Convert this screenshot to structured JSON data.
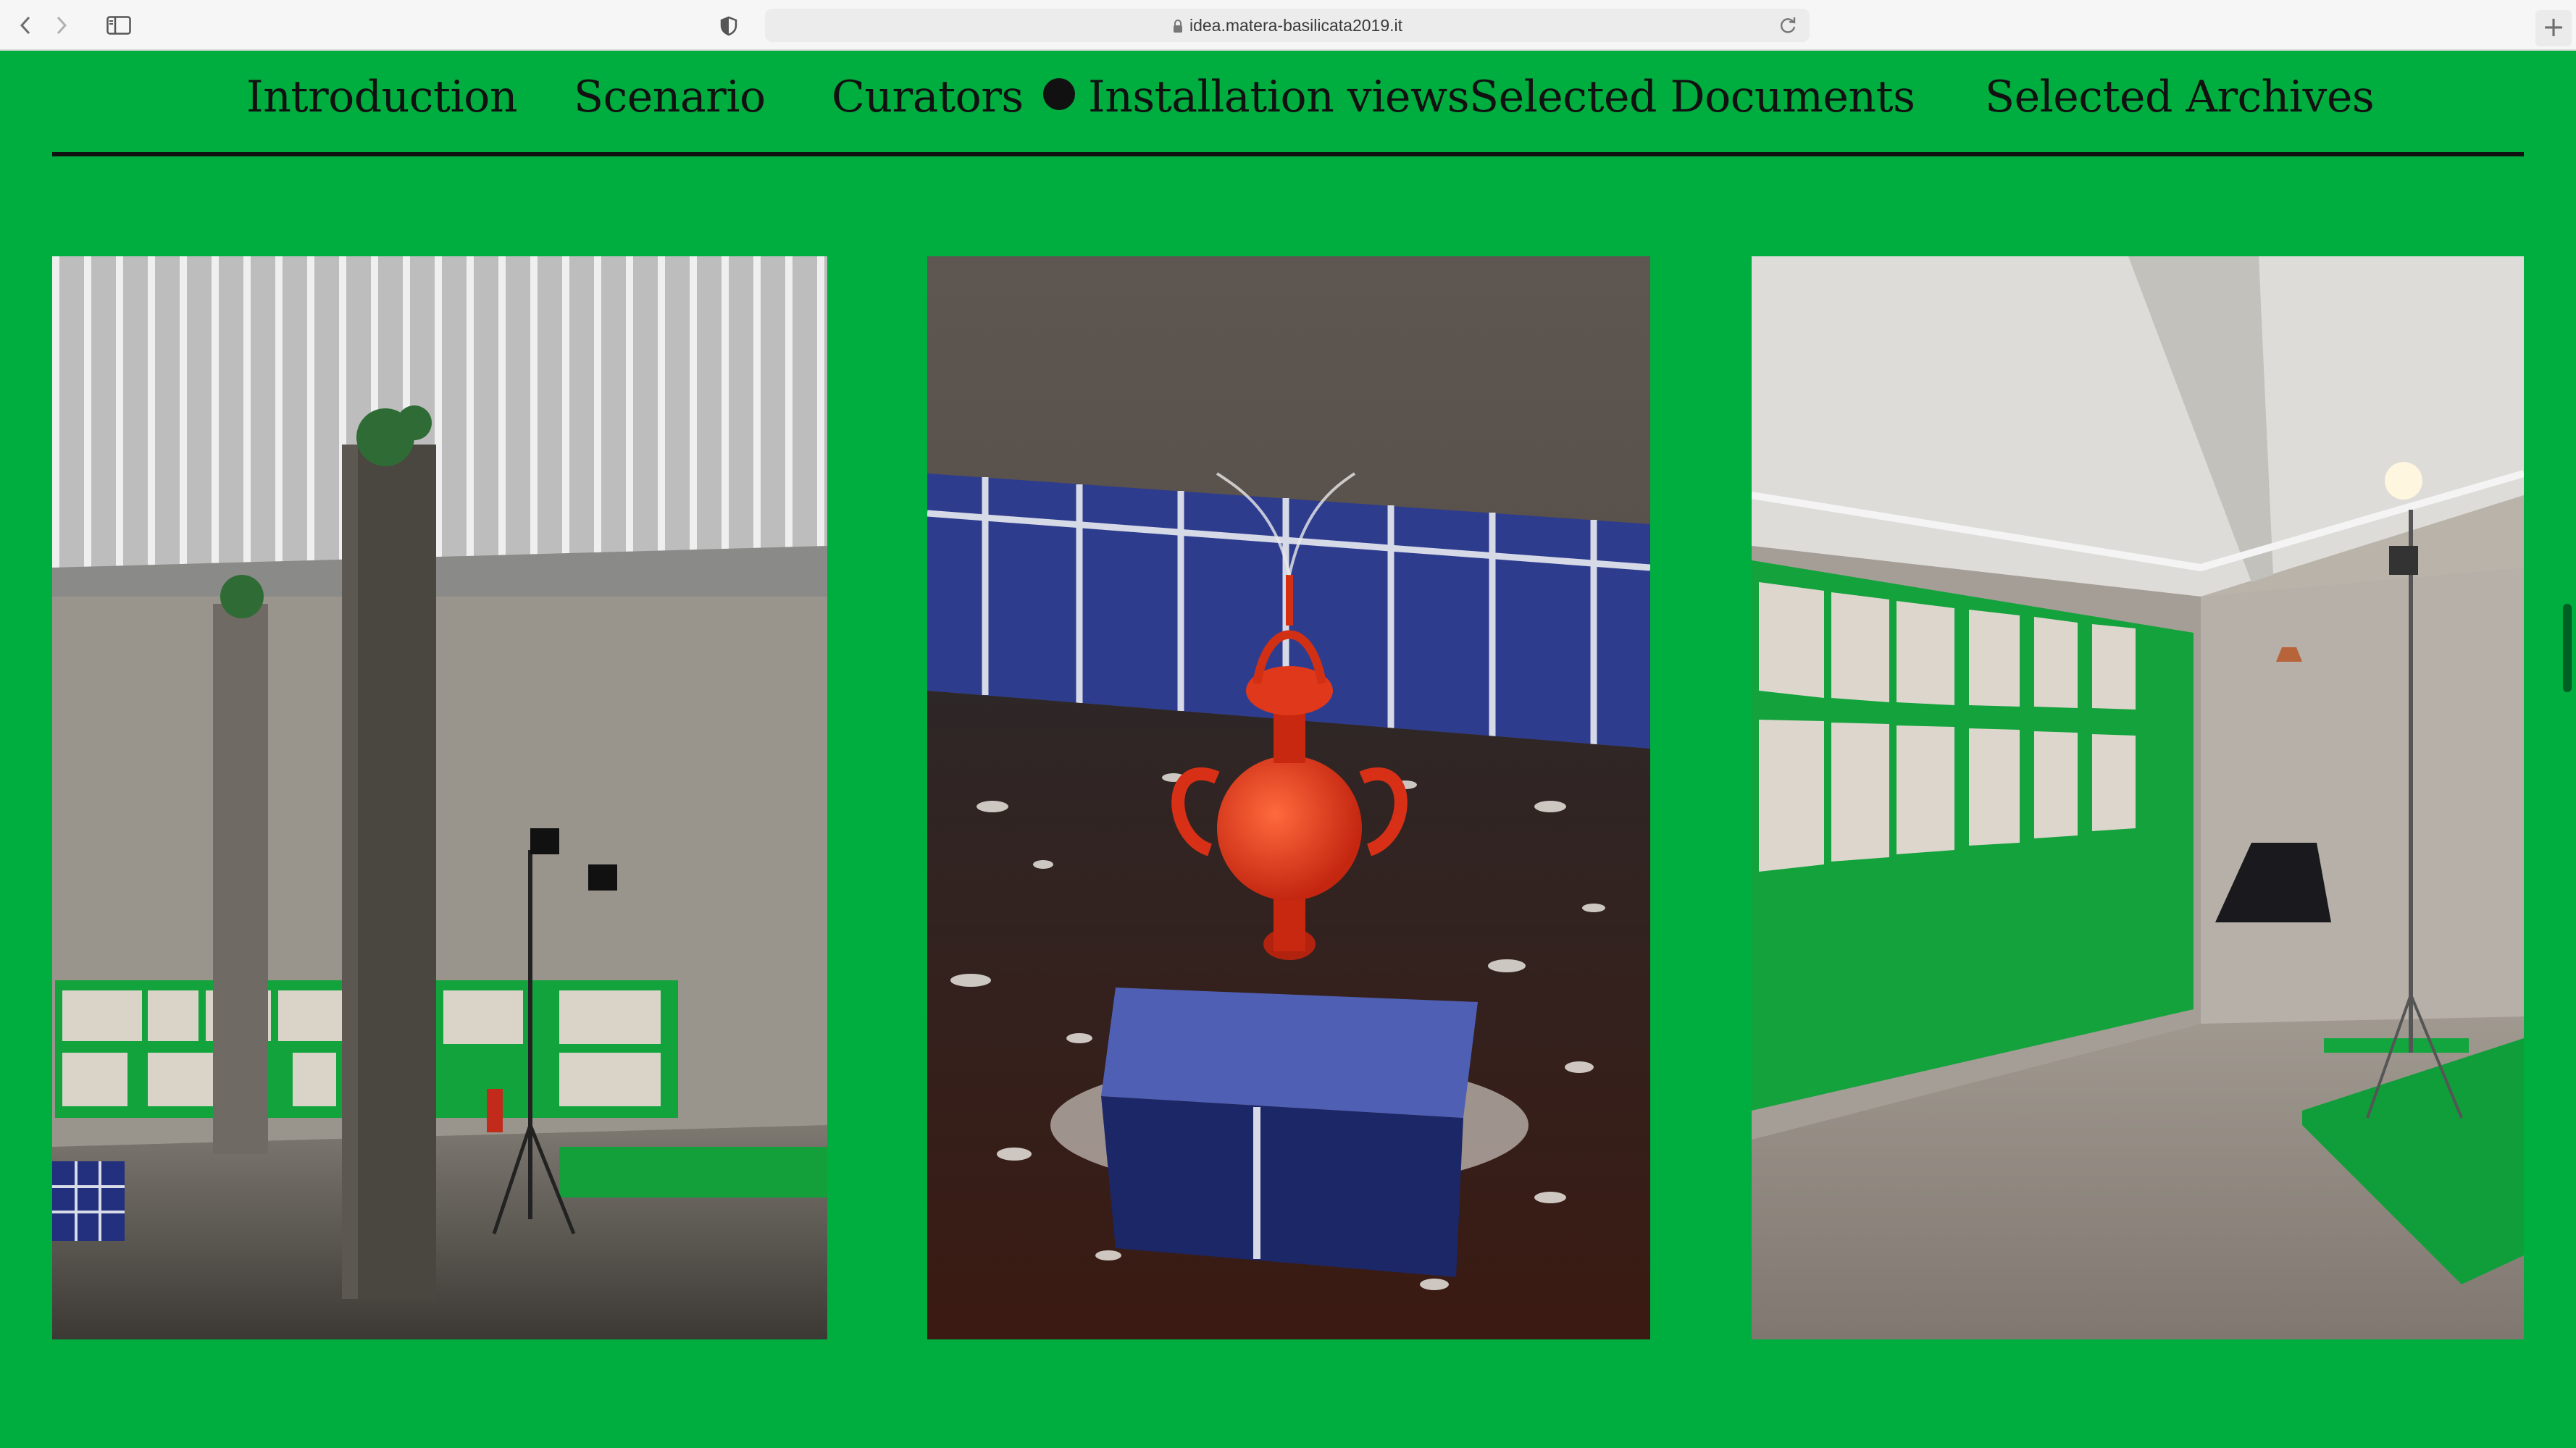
{
  "browser": {
    "url": "idea.matera-basilicata2019.it",
    "icons": [
      "chevron-left-icon",
      "chevron-right-icon",
      "sidebar-icon",
      "shield-icon",
      "lock-icon",
      "reload-icon",
      "plus-icon"
    ]
  },
  "site_nav": {
    "items": [
      {
        "label": "Introduction"
      },
      {
        "label": "Scenario"
      },
      {
        "label": "Curators"
      },
      {
        "label": "Installation views",
        "active": true
      },
      {
        "label": "Selected Documents"
      },
      {
        "label": "Selected Archives"
      }
    ]
  },
  "colors": {
    "background": "#00ad3f",
    "text": "#111111",
    "accent_blue": "#3d4fa6",
    "accent_red": "#e33a1c"
  }
}
